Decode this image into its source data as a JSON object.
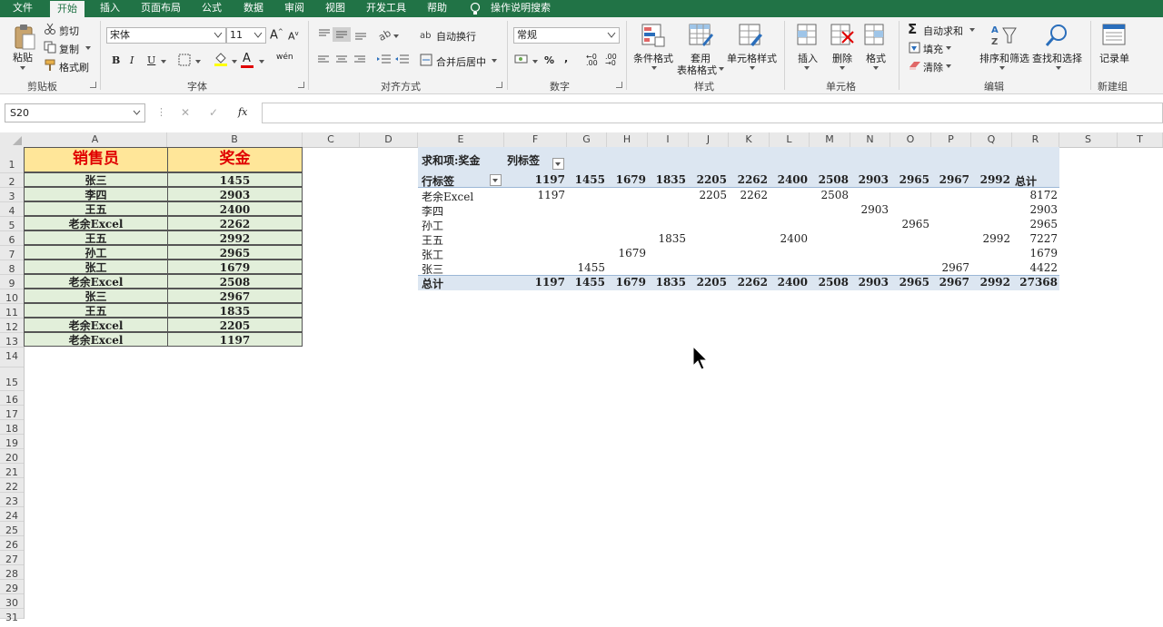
{
  "tabs": [
    "文件",
    "开始",
    "插入",
    "页面布局",
    "公式",
    "数据",
    "审阅",
    "视图",
    "开发工具",
    "帮助"
  ],
  "tell_me": "操作说明搜索",
  "ribbon": {
    "clipboard": {
      "paste": "粘贴",
      "cut": "剪切",
      "copy": "复制",
      "format_painter": "格式刷",
      "label": "剪贴板"
    },
    "font": {
      "name": "宋体",
      "size": "11",
      "label": "字体",
      "bold": "B",
      "italic": "I",
      "underline": "U",
      "font_color": "A",
      "phonetic": "wén"
    },
    "alignment": {
      "wrap": "自动换行",
      "merge": "合并后居中",
      "label": "对齐方式"
    },
    "number": {
      "format": "常规",
      "percent": "%",
      "comma": ",",
      "label": "数字"
    },
    "styles": {
      "conditional": "条件格式",
      "table_format_1": "套用",
      "table_format_2": "表格格式",
      "cell_styles": "单元格样式",
      "label": "样式"
    },
    "cells": {
      "insert": "插入",
      "delete": "删除",
      "format": "格式",
      "label": "单元格"
    },
    "editing": {
      "autosum": "自动求和",
      "fill": "填充",
      "clear": "清除",
      "sort": "排序和筛选",
      "find": "查找和选择",
      "label": "编辑"
    },
    "newgroup": {
      "record": "记录单",
      "label": "新建组"
    }
  },
  "formula_bar": {
    "name_box": "S20",
    "fx": "fx",
    "cancel": "✕",
    "enter": "✓",
    "value": ""
  },
  "columns": [
    "A",
    "B",
    "C",
    "D",
    "E",
    "F",
    "G",
    "H",
    "I",
    "J",
    "K",
    "L",
    "M",
    "N",
    "O",
    "P",
    "Q",
    "R",
    "S",
    "T"
  ],
  "rows": [
    "1",
    "2",
    "3",
    "4",
    "5",
    "6",
    "7",
    "8",
    "9",
    "10",
    "11",
    "12",
    "13",
    "14",
    "15",
    "16",
    "17",
    "18",
    "19",
    "20",
    "21",
    "22",
    "23",
    "24",
    "25",
    "26",
    "27",
    "28",
    "29",
    "30",
    "31"
  ],
  "source_table": {
    "headers": [
      "销售员",
      "奖金"
    ],
    "rows": [
      [
        "张三",
        "1455"
      ],
      [
        "李四",
        "2903"
      ],
      [
        "王五",
        "2400"
      ],
      [
        "老余Excel",
        "2262"
      ],
      [
        "王五",
        "2992"
      ],
      [
        "孙工",
        "2965"
      ],
      [
        "张工",
        "1679"
      ],
      [
        "老余Excel",
        "2508"
      ],
      [
        "张三",
        "2967"
      ],
      [
        "王五",
        "1835"
      ],
      [
        "老余Excel",
        "2205"
      ],
      [
        "老余Excel",
        "1197"
      ]
    ]
  },
  "pivot": {
    "title": "求和项:奖金",
    "col_label": "列标签",
    "row_label": "行标签",
    "columns": [
      "1197",
      "1455",
      "1679",
      "1835",
      "2205",
      "2262",
      "2400",
      "2508",
      "2903",
      "2965",
      "2967",
      "2992",
      "总计"
    ],
    "rows": [
      {
        "name": "老余Excel",
        "values": [
          "1197",
          "",
          "",
          "",
          "2205",
          "2262",
          "",
          "2508",
          "",
          "",
          "",
          "",
          "8172"
        ]
      },
      {
        "name": "李四",
        "values": [
          "",
          "",
          "",
          "",
          "",
          "",
          "",
          "",
          "2903",
          "",
          "",
          "",
          "2903"
        ]
      },
      {
        "name": "孙工",
        "values": [
          "",
          "",
          "",
          "",
          "",
          "",
          "",
          "",
          "",
          "2965",
          "",
          "",
          "2965"
        ]
      },
      {
        "name": "王五",
        "values": [
          "",
          "",
          "",
          "1835",
          "",
          "",
          "2400",
          "",
          "",
          "",
          "",
          "2992",
          "7227"
        ]
      },
      {
        "name": "张工",
        "values": [
          "",
          "",
          "1679",
          "",
          "",
          "",
          "",
          "",
          "",
          "",
          "",
          "",
          "1679"
        ]
      },
      {
        "name": "张三",
        "values": [
          "",
          "1455",
          "",
          "",
          "",
          "",
          "",
          "",
          "",
          "",
          "2967",
          "",
          "4422"
        ]
      }
    ],
    "total_label": "总计",
    "totals": [
      "1197",
      "1455",
      "1679",
      "1835",
      "2205",
      "2262",
      "2400",
      "2508",
      "2903",
      "2965",
      "2967",
      "2992",
      "27368"
    ]
  }
}
